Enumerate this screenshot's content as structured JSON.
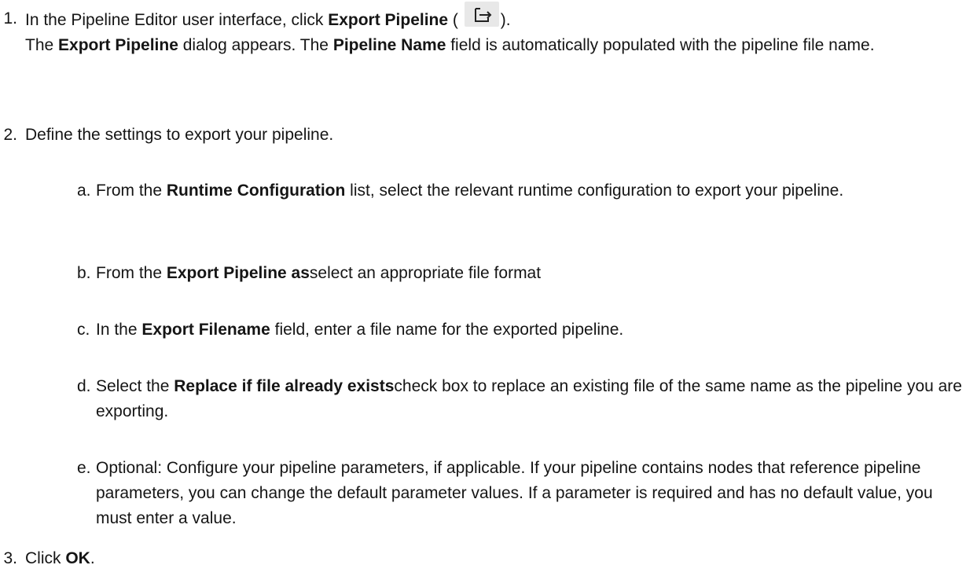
{
  "steps": [
    {
      "number": "1.",
      "line1": {
        "t1": "In the Pipeline Editor user interface, click ",
        "b1": "Export Pipeline",
        "t2": " (",
        "t3": ")."
      },
      "line2": {
        "t1": "The ",
        "b1": "Export Pipeline",
        "t2": " dialog appears. The ",
        "b2": "Pipeline Name",
        "t3": " field is automatically populated with the pipeline file name."
      },
      "icon": "export-pipeline-icon"
    },
    {
      "number": "2.",
      "text": "Define the settings to export your pipeline.",
      "substeps": [
        {
          "letter": "a.",
          "t1": "From the ",
          "b1": "Runtime Configuration",
          "t2": " list, select the relevant runtime configuration to export your pipeline."
        },
        {
          "letter": "b.",
          "t1": "From the ",
          "b1": "Export Pipeline as",
          "t2": "select an appropriate file format"
        },
        {
          "letter": "c.",
          "t1": "In the ",
          "b1": "Export Filename",
          "t2": " field, enter a file name for the exported pipeline."
        },
        {
          "letter": "d.",
          "t1": "Select the ",
          "b1": "Replace if file already exists",
          "t2": "check box to replace an existing file of the same name as the pipeline you are exporting."
        },
        {
          "letter": "e.",
          "t1": "Optional: Configure your pipeline parameters, if applicable. If your pipeline contains nodes that reference pipeline parameters, you can change the default parameter values. If a parameter is required and has no default value, you must enter a value."
        }
      ]
    },
    {
      "number": "3.",
      "t1": "Click ",
      "b1": "OK",
      "t2": "."
    }
  ]
}
